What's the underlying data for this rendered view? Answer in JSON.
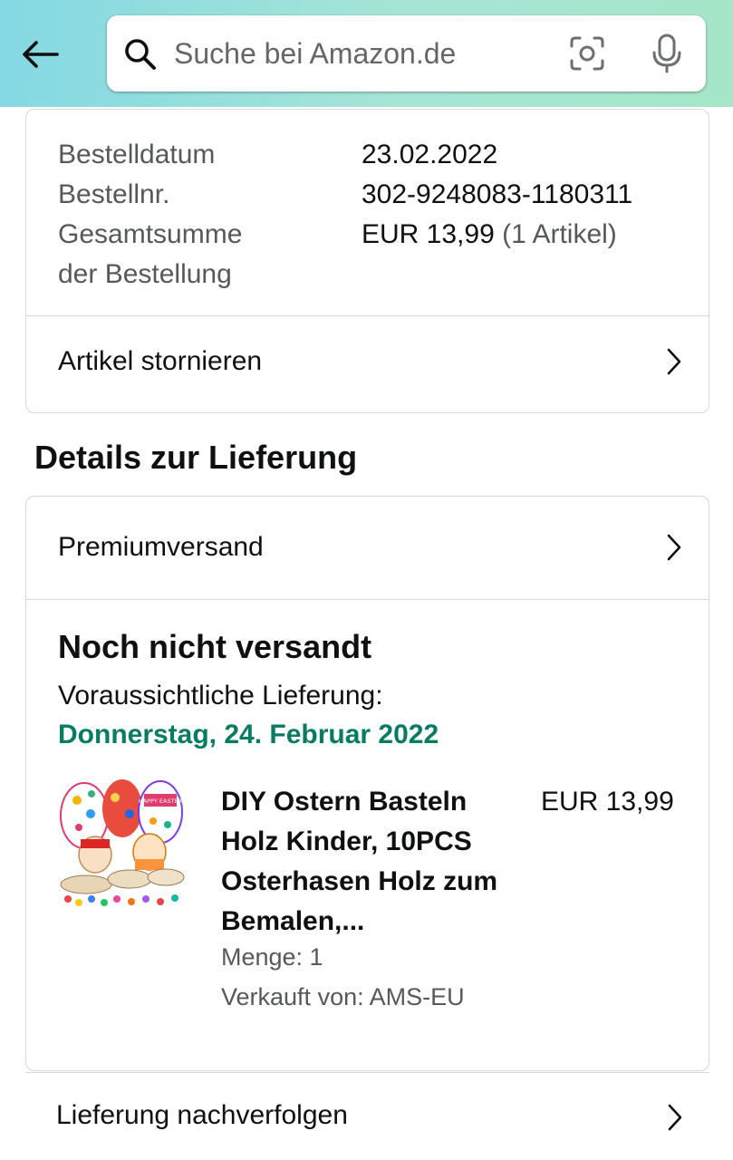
{
  "header": {
    "search_placeholder": "Suche bei Amazon.de",
    "icons": [
      "back-arrow-icon",
      "search-icon",
      "camera-icon",
      "mic-icon"
    ]
  },
  "order_summary": {
    "rows": [
      {
        "label": "Bestelldatum",
        "value": "23.02.2022"
      },
      {
        "label": "Bestellnr.",
        "value": "302-9248083-1180311"
      },
      {
        "label_line1": "Gesamtsumme",
        "label_line2": "der Bestellung",
        "value": "EUR 13,99",
        "value_suffix": "(1 Artikel)"
      }
    ],
    "cancel_label": "Artikel stornieren"
  },
  "delivery": {
    "section_title": "Details zur Lieferung",
    "shipping_method": "Premiumversand",
    "status": "Noch nicht versandt",
    "eta_label": "Voraussichtliche Lieferung:",
    "eta_date": "Donnerstag, 24. Februar 2022",
    "eta_color": "#067d62",
    "product": {
      "title": "DIY Ostern Basteln Holz Kinder, 10PCS Osterhasen Holz zum Bemalen,...",
      "price": "EUR 13,99",
      "quantity": "Menge: 1",
      "seller": "Verkauft von: AMS-EU",
      "image_text": "HAPPY EASTER"
    },
    "track_label": "Lieferung nachverfolgen"
  }
}
